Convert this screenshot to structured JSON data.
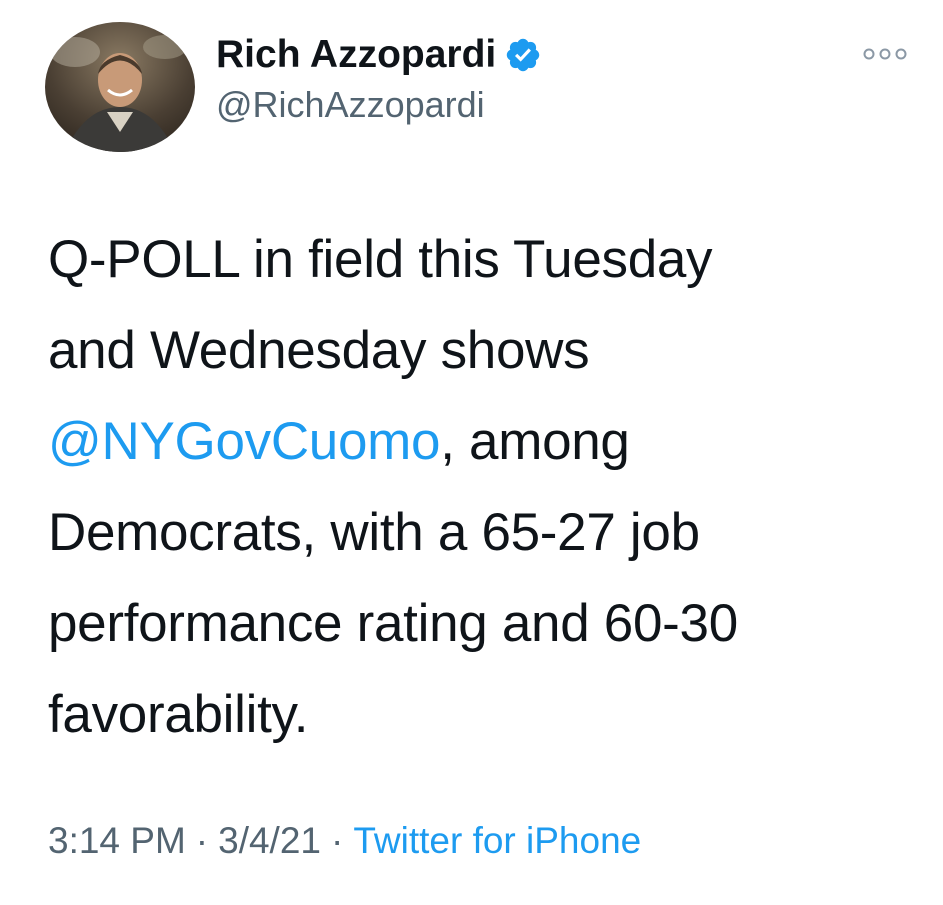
{
  "tweet": {
    "author": {
      "display_name": "Rich Azzopardi",
      "handle": "@RichAzzopardi",
      "verified": true,
      "avatar_icon": "profile-photo"
    },
    "text": {
      "line1": "Q-POLL in field this Tuesday",
      "line2": "and Wednesday shows",
      "mention": "@NYGovCuomo",
      "line3_rest": ", among",
      "line4": "Democrats, with a 65-27 job",
      "line5": "performance rating and 60-30",
      "line6": "favorability."
    },
    "meta": {
      "time": "3:14 PM",
      "separator": "·",
      "date": "3/4/21",
      "source": "Twitter for iPhone"
    },
    "icons": {
      "more": "more-horizontal-icon",
      "verified": "verified-badge-icon"
    },
    "colors": {
      "link": "#1d9bf0",
      "secondary_text": "#536471",
      "primary_text": "#0f1419",
      "verified_badge": "#1d9bf0"
    }
  }
}
